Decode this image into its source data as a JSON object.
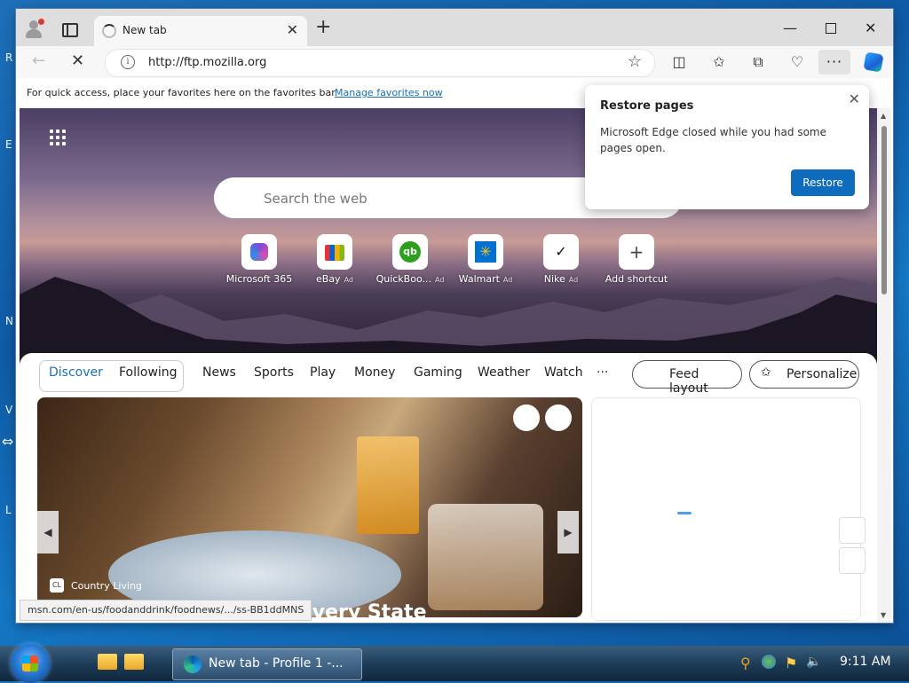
{
  "desktop": {
    "edge_letters": [
      "R",
      "E",
      "N",
      "V",
      "L"
    ]
  },
  "tab": {
    "title": "New tab"
  },
  "addressbar": {
    "url": "http://ftp.mozilla.org"
  },
  "favorites_bar": {
    "message": "For quick access, place your favorites here on the favorites bar.",
    "link": "Manage favorites now"
  },
  "newtab": {
    "search_placeholder": "Search the web",
    "shortcuts": [
      {
        "label": "Microsoft 365",
        "ad": "",
        "icon": "microsoft365-icon"
      },
      {
        "label": "eBay",
        "ad": "Ad",
        "icon": "ebay-icon"
      },
      {
        "label": "QuickBoo...",
        "ad": "Ad",
        "icon": "quickbooks-icon"
      },
      {
        "label": "Walmart",
        "ad": "Ad",
        "icon": "walmart-icon"
      },
      {
        "label": "Nike",
        "ad": "Ad",
        "icon": "nike-icon"
      },
      {
        "label": "Add shortcut",
        "ad": "",
        "icon": "plus-icon"
      }
    ]
  },
  "feed": {
    "tabs": [
      "Discover",
      "Following"
    ],
    "active_tab": "Discover",
    "categories": [
      "News",
      "Sports",
      "Play",
      "Money",
      "Gaming",
      "Weather",
      "Watch"
    ],
    "more": "···",
    "feed_layout_label": "Feed layout",
    "personalize_label": "Personalize",
    "card": {
      "source_badge": "CL",
      "source": "Country Living",
      "headline_fragment": "nt in Every State"
    }
  },
  "status_url": "msn.com/en-us/foodanddrink/foodnews/.../ss-BB1ddMNS",
  "popup": {
    "title": "Restore pages",
    "body": "Microsoft Edge closed while you had some pages open.",
    "button": "Restore"
  },
  "taskbar": {
    "task_label": "New tab - Profile 1 -...",
    "clock": "9:11 AM"
  },
  "colors": {
    "accent": "#0f6cbd",
    "link": "#1a6fb3",
    "desktop": "#1565b5"
  }
}
